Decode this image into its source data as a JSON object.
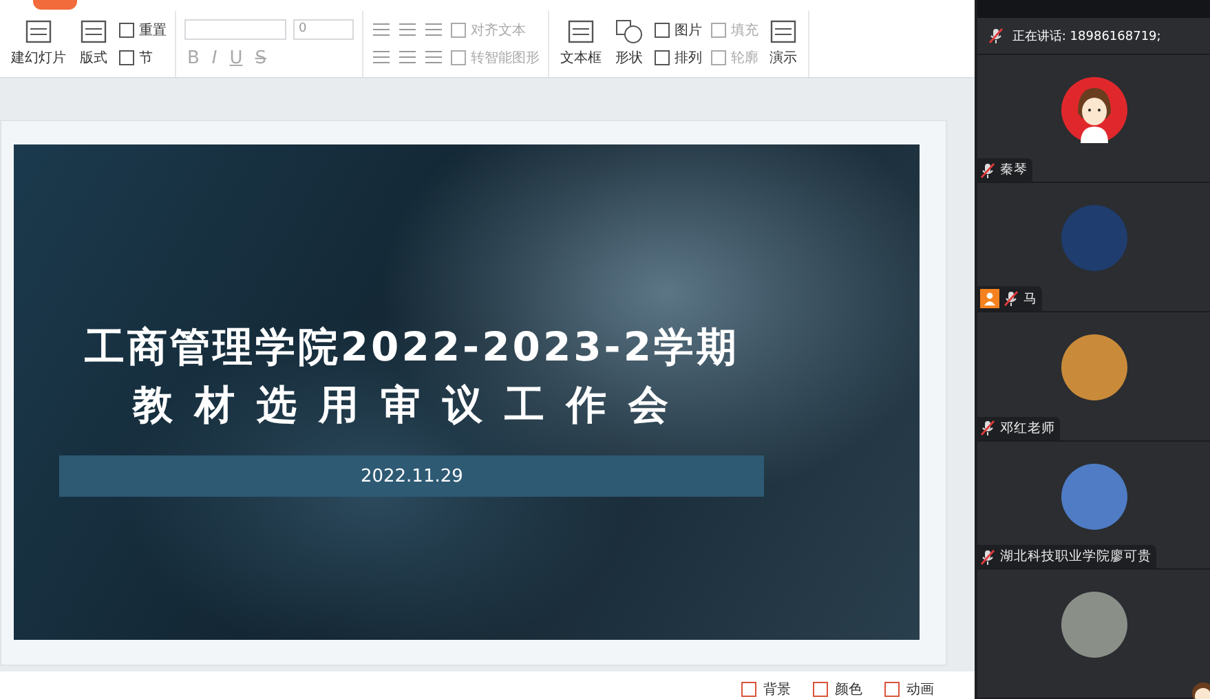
{
  "toolbar": {
    "new_slide": "建幻灯片",
    "layout": "版式",
    "reset": "重置",
    "section": "节",
    "font_size": "0",
    "format_glyphs": [
      {
        "label": "B",
        "disabled": true
      },
      {
        "label": "I",
        "disabled": true
      },
      {
        "label": "U",
        "disabled": true
      },
      {
        "label": "S",
        "disabled": true
      }
    ],
    "align_text": {
      "label": "对齐文本",
      "disabled": true
    },
    "smart_art": {
      "label": "转智能图形",
      "disabled": true
    },
    "text_box": "文本框",
    "shape": "形状",
    "picture": "图片",
    "arrange": "排列",
    "fill": {
      "label": "填充",
      "disabled": true
    },
    "outline": {
      "label": "轮廓",
      "disabled": true
    },
    "present": "演示"
  },
  "slide": {
    "title_lines": [
      "工商管理学院2022-2023-2学期",
      "教材选用审议工作会"
    ],
    "date": "2022.11.29"
  },
  "bottom_bar": {
    "items": [
      "背景",
      "颜色",
      "动画"
    ]
  },
  "meeting": {
    "speaking": "正在讲话: 18986168719;",
    "participants": [
      {
        "name": "秦琴",
        "mic_muted": true,
        "host": false,
        "kind": "cartoon"
      },
      {
        "name": "马",
        "mic_muted": true,
        "host": true,
        "kind": "photo"
      },
      {
        "name": "邓红老师",
        "mic_muted": true,
        "host": false,
        "kind": "photo"
      },
      {
        "name": "湖北科技职业学院廖可贵",
        "mic_muted": true,
        "host": false,
        "kind": "photo"
      },
      {
        "kind": "photo"
      }
    ]
  }
}
